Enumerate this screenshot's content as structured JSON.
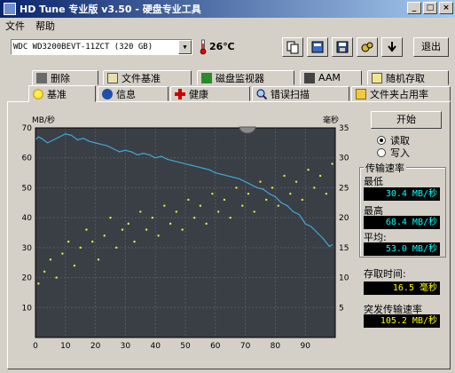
{
  "window": {
    "title": "HD Tune 专业版 v3.50 - 硬盘专业工具"
  },
  "menu": [
    "文件",
    "帮助"
  ],
  "toolbar": {
    "drive": "WDC WD3200BEVT-11ZCT (320 GB)",
    "temperature": "26℃",
    "exit_label": "退出",
    "icons": [
      "copy-icon",
      "info-icon",
      "save-icon",
      "settings-icon",
      "download-icon"
    ]
  },
  "tabs": {
    "row1": [
      "删除",
      "文件基准",
      "磁盘监视器",
      "AAM",
      "随机存取"
    ],
    "row2": [
      "基准",
      "信息",
      "健康",
      "错误扫描",
      "文件夹占用率"
    ],
    "active": "基准"
  },
  "controls": {
    "start_label": "开始",
    "mode_options": [
      "读取",
      "写入"
    ],
    "selected_mode": "读取"
  },
  "stats": {
    "transfer_title": "传输速率",
    "min_label": "最低",
    "min_value": "30.4 MB/秒",
    "max_label": "最高",
    "max_value": "68.4 MB/秒",
    "avg_label": "平均:",
    "avg_value": "53.0 MB/秒",
    "access_label": "存取时间:",
    "access_value": "16.5 毫秒",
    "burst_label": "突发传输速率",
    "burst_value": "105.2 MB/秒"
  },
  "chart_data": {
    "type": "line",
    "ylabel_left": "MB/秒",
    "ylabel_right": "毫秒",
    "x_ticks": [
      0,
      10,
      20,
      30,
      40,
      50,
      60,
      70,
      80,
      90
    ],
    "y_left_ticks": [
      10,
      20,
      30,
      40,
      50,
      60,
      70
    ],
    "y_right_ticks": [
      5,
      10,
      15,
      20,
      25,
      30,
      35
    ],
    "xlim": [
      0,
      100
    ],
    "ylim_left": [
      0,
      70
    ],
    "ylim_right": [
      0,
      35
    ],
    "grid": true,
    "series": [
      {
        "color": "#3fa7d6",
        "x": [
          0,
          1,
          2,
          4,
          6,
          8,
          10,
          12,
          14,
          16,
          18,
          20,
          22,
          24,
          26,
          28,
          30,
          32,
          34,
          36,
          38,
          40,
          42,
          44,
          46,
          48,
          50,
          52,
          54,
          56,
          58,
          60,
          62,
          64,
          66,
          68,
          70,
          72,
          74,
          76,
          78,
          80,
          82,
          84,
          86,
          88,
          90,
          92,
          94,
          96,
          98,
          99
        ],
        "values": [
          66,
          67,
          66.5,
          65,
          66,
          67,
          68,
          67.5,
          66,
          66.5,
          65.5,
          65,
          64.5,
          64,
          63,
          62,
          62.5,
          62,
          61,
          61.5,
          61,
          60,
          60.5,
          59.5,
          59,
          58.5,
          58,
          57.5,
          57,
          56.5,
          56,
          55,
          54.5,
          54,
          53.5,
          53,
          52,
          51,
          50,
          49.5,
          48,
          47,
          45,
          44,
          42,
          41,
          38,
          37,
          35,
          33,
          30.4,
          31
        ]
      },
      {
        "color": "#e8e84a",
        "type": "scatter",
        "x": [
          1,
          3,
          5,
          7,
          9,
          11,
          13,
          15,
          17,
          19,
          21,
          23,
          25,
          27,
          29,
          31,
          33,
          35,
          37,
          39,
          41,
          43,
          45,
          47,
          49,
          51,
          53,
          55,
          57,
          59,
          61,
          63,
          65,
          67,
          69,
          71,
          73,
          75,
          77,
          79,
          81,
          83,
          85,
          87,
          89,
          91,
          93,
          95,
          97,
          99
        ],
        "values": [
          9,
          11,
          13,
          10,
          14,
          16,
          12,
          15,
          18,
          16,
          13,
          17,
          20,
          15,
          18,
          19,
          16,
          21,
          18,
          20,
          17,
          22,
          19,
          21,
          18,
          23,
          20,
          22,
          19,
          24,
          21,
          23,
          20,
          25,
          22,
          24,
          21,
          26,
          23,
          25,
          22,
          27,
          24,
          26,
          23,
          28,
          25,
          27,
          24,
          29
        ]
      }
    ]
  }
}
